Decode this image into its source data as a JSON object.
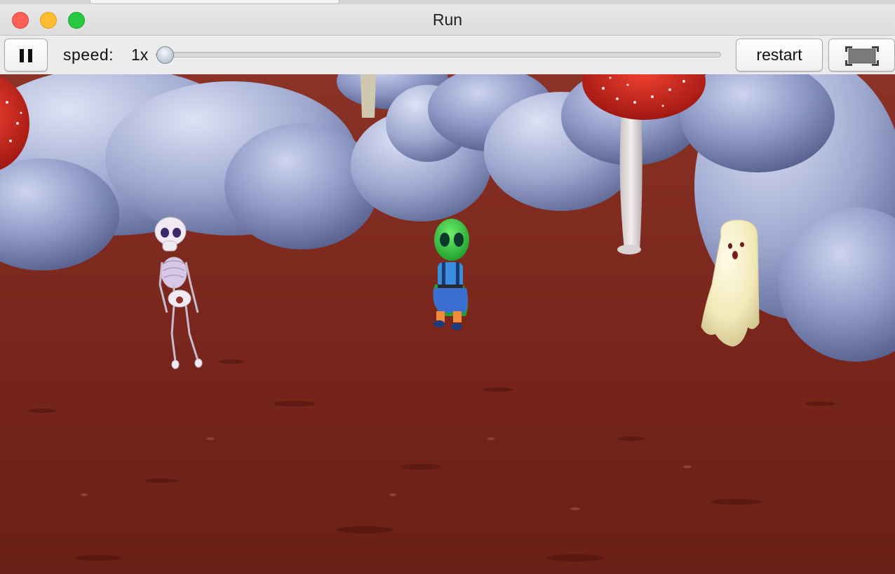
{
  "window": {
    "title": "Run"
  },
  "toolbar": {
    "speed_label": "speed:",
    "speed_value": "1x",
    "speed_slider_level": 0,
    "restart_label": "restart"
  },
  "icons": {
    "pause": "pause-icon",
    "fullscreen": "fullscreen-icon"
  },
  "colors": {
    "close": "#fe5f57",
    "minimize": "#febc2e",
    "maximize": "#28c840",
    "ground": "#7a261c",
    "rocks": "#8e99c6"
  },
  "scene": {
    "characters": [
      "skeleton",
      "alien",
      "ghost"
    ]
  }
}
